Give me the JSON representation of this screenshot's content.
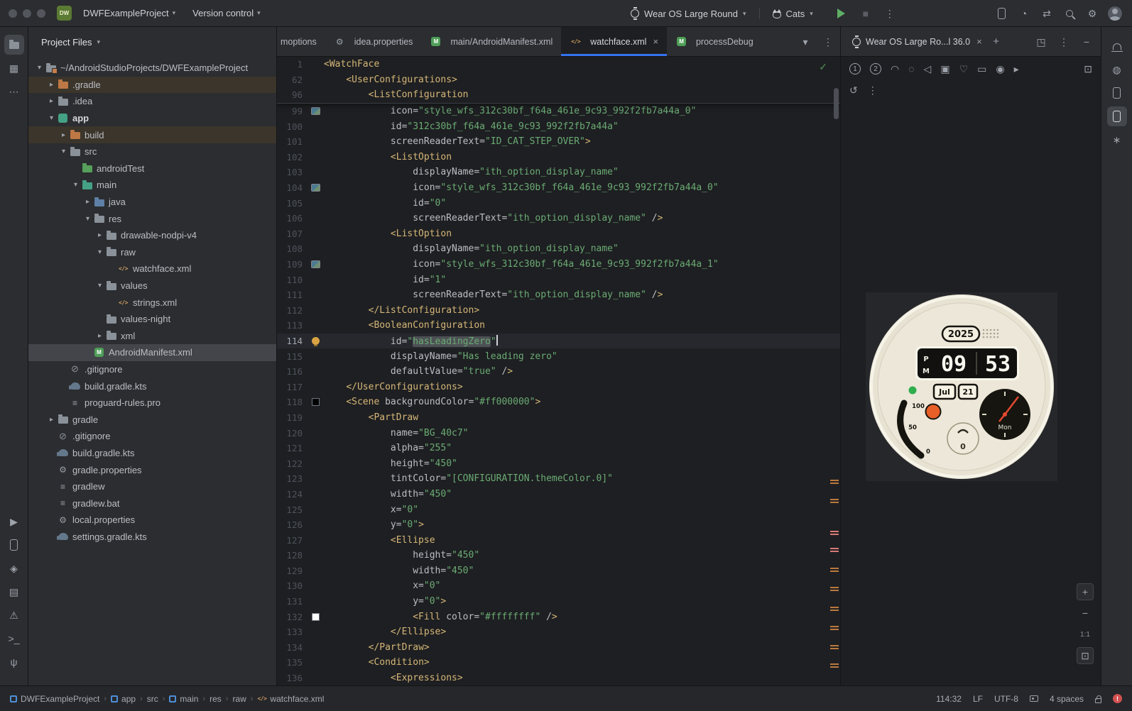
{
  "colors": {
    "chrome": "#2b2d30",
    "editor_bg": "#1e1f22",
    "accent_blue": "#3574f0",
    "tag_gold": "#d5b778",
    "string_green": "#6aab73",
    "run_green": "#5fad65",
    "error_red": "#d35050"
  },
  "titlebar": {
    "logo": "DW",
    "project_menu": "DWFExampleProject",
    "vcs_menu": "Version control",
    "device_selector": "Wear OS Large Round",
    "run_config": "Cats",
    "run_icons": [
      {
        "name": "run-button",
        "glyph": "run"
      },
      {
        "name": "stop-button",
        "glyph": "■"
      },
      {
        "name": "more-run-options-button",
        "glyph": "⋮"
      }
    ],
    "right_icons": [
      {
        "name": "device-mirror-button",
        "glyph": "phone"
      },
      {
        "name": "profiler-button",
        "glyph": "◔"
      },
      {
        "name": "sync-button",
        "glyph": "⇄"
      },
      {
        "name": "search-everywhere-button",
        "glyph": "mag"
      },
      {
        "name": "settings-button",
        "glyph": "⚙"
      },
      {
        "name": "account-button",
        "glyph": "avatar"
      }
    ]
  },
  "tool_strips": {
    "left_top": [
      {
        "name": "project-tool-button",
        "glyph": "folder",
        "active": true
      },
      {
        "name": "commit-tool-button",
        "glyph": "▦",
        "active": false
      },
      {
        "name": "more-tool-windows-button",
        "glyph": "⋯",
        "active": false
      }
    ],
    "left_bottom": [
      {
        "name": "run-tool-button",
        "glyph": "▶"
      },
      {
        "name": "device-manager-tool-button",
        "glyph": "phone"
      },
      {
        "name": "app-quality-insights-tool-button",
        "glyph": "◈"
      },
      {
        "name": "logcat-tool-button",
        "glyph": "▤"
      },
      {
        "name": "problems-tool-button",
        "glyph": "⚠"
      },
      {
        "name": "terminal-tool-button",
        "glyph": ">_"
      },
      {
        "name": "version-control-tool-button",
        "glyph": "ψ"
      }
    ],
    "right": [
      {
        "name": "notifications-button",
        "glyph": "bell",
        "active": false
      },
      {
        "name": "gradle-tool-button",
        "glyph": "◍",
        "active": false
      },
      {
        "name": "device-explorer-tool-button",
        "glyph": "phone",
        "active": false
      },
      {
        "name": "running-devices-tool-button",
        "glyph": "phone",
        "active": true
      },
      {
        "name": "gemini-tool-button",
        "glyph": "∗",
        "active": false
      }
    ]
  },
  "project": {
    "header": "Project Files",
    "tree": [
      {
        "d": 0,
        "label": "~/AndroidStudioProjects/DWFExampleProject",
        "icon": "project",
        "chev": "open"
      },
      {
        "d": 1,
        "label": ".gradle",
        "icon": "folder-ex",
        "chev": "closed",
        "row": "excluded"
      },
      {
        "d": 1,
        "label": ".idea",
        "icon": "folder",
        "chev": "closed"
      },
      {
        "d": 1,
        "label": "app",
        "icon": "module",
        "chev": "open",
        "bold": true
      },
      {
        "d": 2,
        "label": "build",
        "icon": "folder-ex",
        "chev": "closed",
        "row": "excluded"
      },
      {
        "d": 2,
        "label": "src",
        "icon": "folder",
        "chev": "open"
      },
      {
        "d": 3,
        "label": "androidTest",
        "icon": "folder-test",
        "chev": null
      },
      {
        "d": 3,
        "label": "main",
        "icon": "folder-main",
        "chev": "open"
      },
      {
        "d": 4,
        "label": "java",
        "icon": "folder-java",
        "chev": "closed"
      },
      {
        "d": 4,
        "label": "res",
        "icon": "folder",
        "chev": "open"
      },
      {
        "d": 5,
        "label": "drawable-nodpi-v4",
        "icon": "folder",
        "chev": "closed"
      },
      {
        "d": 5,
        "label": "raw",
        "icon": "folder",
        "chev": "open"
      },
      {
        "d": 6,
        "label": "watchface.xml",
        "icon": "xml",
        "chev": null
      },
      {
        "d": 5,
        "label": "values",
        "icon": "folder",
        "chev": "open"
      },
      {
        "d": 6,
        "label": "strings.xml",
        "icon": "xml",
        "chev": null
      },
      {
        "d": 5,
        "label": "values-night",
        "icon": "folder",
        "chev": null
      },
      {
        "d": 5,
        "label": "xml",
        "icon": "folder",
        "chev": "closed"
      },
      {
        "d": 4,
        "label": "AndroidManifest.xml",
        "icon": "manifest",
        "chev": null,
        "row": "selected"
      },
      {
        "d": 2,
        "label": ".gitignore",
        "icon": "git",
        "chev": null
      },
      {
        "d": 2,
        "label": "build.gradle.kts",
        "icon": "gradle",
        "chev": null
      },
      {
        "d": 2,
        "label": "proguard-rules.pro",
        "icon": "textfile",
        "chev": null
      },
      {
        "d": 1,
        "label": "gradle",
        "icon": "folder",
        "chev": "closed"
      },
      {
        "d": 1,
        "label": ".gitignore",
        "icon": "git",
        "chev": null
      },
      {
        "d": 1,
        "label": "build.gradle.kts",
        "icon": "gradle",
        "chev": null
      },
      {
        "d": 1,
        "label": "gradle.properties",
        "icon": "props",
        "chev": null
      },
      {
        "d": 1,
        "label": "gradlew",
        "icon": "textfile",
        "chev": null
      },
      {
        "d": 1,
        "label": "gradlew.bat",
        "icon": "textfile",
        "chev": null
      },
      {
        "d": 1,
        "label": "local.properties",
        "icon": "props",
        "chev": null
      },
      {
        "d": 1,
        "label": "settings.gradle.kts",
        "icon": "gradle",
        "chev": null
      }
    ]
  },
  "tabs": {
    "items": [
      {
        "label": "moptions",
        "icon": null,
        "cut": true
      },
      {
        "label": "idea.properties",
        "icon": "props"
      },
      {
        "label": "main/AndroidManifest.xml",
        "icon": "manifest"
      },
      {
        "label": "watchface.xml",
        "icon": "xml",
        "active": true,
        "close": true
      },
      {
        "label": "processDebug",
        "icon": "manifest",
        "truncate": true
      }
    ],
    "controls": [
      {
        "name": "hidden-tabs-button",
        "glyph": "▾"
      },
      {
        "name": "editor-options-button",
        "glyph": "⋮"
      }
    ]
  },
  "editor": {
    "sticky": [
      {
        "n": 1,
        "t": "<WatchFace"
      },
      {
        "n": 62,
        "t": "    <UserConfigurations>"
      },
      {
        "n": 96,
        "t": "        <ListConfiguration"
      }
    ],
    "lines": [
      {
        "n": 99,
        "t": "            icon=\"style_wfs_312c30bf_f64a_461e_9c93_992f2fb7a44a_0\"",
        "g": "img"
      },
      {
        "n": 100,
        "t": "            id=\"312c30bf_f64a_461e_9c93_992f2fb7a44a\""
      },
      {
        "n": 101,
        "t": "            screenReaderText=\"ID_CAT_STEP_OVER\">"
      },
      {
        "n": 102,
        "t": "            <ListOption"
      },
      {
        "n": 103,
        "t": "                displayName=\"ith_option_display_name\""
      },
      {
        "n": 104,
        "t": "                icon=\"style_wfs_312c30bf_f64a_461e_9c93_992f2fb7a44a_0\"",
        "g": "img"
      },
      {
        "n": 105,
        "t": "                id=\"0\""
      },
      {
        "n": 106,
        "t": "                screenReaderText=\"ith_option_display_name\" />"
      },
      {
        "n": 107,
        "t": "            <ListOption"
      },
      {
        "n": 108,
        "t": "                displayName=\"ith_option_display_name\""
      },
      {
        "n": 109,
        "t": "                icon=\"style_wfs_312c30bf_f64a_461e_9c93_992f2fb7a44a_1\"",
        "g": "img"
      },
      {
        "n": 110,
        "t": "                id=\"1\""
      },
      {
        "n": 111,
        "t": "                screenReaderText=\"ith_option_display_name\" />"
      },
      {
        "n": 112,
        "t": "        </ListConfiguration>"
      },
      {
        "n": 113,
        "t": "        <BooleanConfiguration"
      },
      {
        "n": 114,
        "t": "            id=\"hasLeadingZero\"",
        "g": "bulb",
        "caret": true,
        "sel": "hasLeadingZero"
      },
      {
        "n": 115,
        "t": "            displayName=\"Has leading zero\""
      },
      {
        "n": 116,
        "t": "            defaultValue=\"true\" />"
      },
      {
        "n": 117,
        "t": "    </UserConfigurations>"
      },
      {
        "n": 118,
        "t": "    <Scene backgroundColor=\"#ff000000\">",
        "g": "swatch:#000000"
      },
      {
        "n": 119,
        "t": "        <PartDraw"
      },
      {
        "n": 120,
        "t": "            name=\"BG_40c7\""
      },
      {
        "n": 121,
        "t": "            alpha=\"255\""
      },
      {
        "n": 122,
        "t": "            height=\"450\""
      },
      {
        "n": 123,
        "t": "            tintColor=\"[CONFIGURATION.themeColor.0]\""
      },
      {
        "n": 124,
        "t": "            width=\"450\""
      },
      {
        "n": 125,
        "t": "            x=\"0\""
      },
      {
        "n": 126,
        "t": "            y=\"0\">"
      },
      {
        "n": 127,
        "t": "            <Ellipse"
      },
      {
        "n": 128,
        "t": "                height=\"450\""
      },
      {
        "n": 129,
        "t": "                width=\"450\""
      },
      {
        "n": 130,
        "t": "                x=\"0\""
      },
      {
        "n": 131,
        "t": "                y=\"0\">"
      },
      {
        "n": 132,
        "t": "                <Fill color=\"#ffffffff\" />",
        "g": "swatch:#ffffff"
      },
      {
        "n": 133,
        "t": "            </Ellipse>"
      },
      {
        "n": 134,
        "t": "        </PartDraw>"
      },
      {
        "n": 135,
        "t": "        <Condition>"
      },
      {
        "n": 136,
        "t": "            <Expressions>"
      }
    ],
    "stripe": [
      {
        "t": 596,
        "c": "#b9793e"
      },
      {
        "t": 623,
        "c": "#b9793e"
      },
      {
        "t": 668,
        "c": "#d57b74"
      },
      {
        "t": 692,
        "c": "#d57b74"
      },
      {
        "t": 720,
        "c": "#b9793e"
      },
      {
        "t": 747,
        "c": "#b9793e"
      },
      {
        "t": 775,
        "c": "#b9793e"
      },
      {
        "t": 802,
        "c": "#b9793e"
      },
      {
        "t": 829,
        "c": "#b9793e"
      },
      {
        "t": 855,
        "c": "#b9793e"
      }
    ]
  },
  "device_panel": {
    "tab_label": "Wear OS Large Ro...l 36.0",
    "header_icons": [
      {
        "name": "open-in-window-button",
        "glyph": "◳"
      },
      {
        "name": "panel-options-button",
        "glyph": "⋮"
      },
      {
        "name": "hide-panel-button",
        "glyph": "−"
      }
    ],
    "toolbar": [
      {
        "name": "wear-button-1",
        "glyph": "1",
        "circle": true
      },
      {
        "name": "wear-button-2",
        "glyph": "2",
        "circle": true
      },
      {
        "name": "palm-gesture-button",
        "glyph": "◠"
      },
      {
        "name": "power-button",
        "glyph": "◌"
      },
      {
        "name": "back-button",
        "glyph": "◁"
      },
      {
        "name": "screenshot-button",
        "glyph": "▣"
      },
      {
        "name": "heart-rate-button",
        "glyph": "♡"
      },
      {
        "name": "pair-button",
        "glyph": "▭"
      },
      {
        "name": "camera-button",
        "glyph": "◉"
      },
      {
        "name": "record-button",
        "glyph": "▸"
      }
    ],
    "fullscreen_glyph": "⊡",
    "toolbar2": [
      {
        "name": "reset-view-button",
        "glyph": "↺"
      },
      {
        "name": "toolbar-more-button",
        "glyph": "⋮"
      }
    ],
    "zoom": [
      {
        "name": "zoom-in-button",
        "glyph": "+",
        "boxed": true
      },
      {
        "name": "zoom-out-button",
        "glyph": "−",
        "boxed": false
      },
      {
        "name": "zoom-level-label",
        "glyph": "1:1",
        "boxed": false,
        "label": true
      },
      {
        "name": "zoom-to-fit-button",
        "glyph": "⊡",
        "boxed": true
      }
    ],
    "watch": {
      "year": "2025",
      "ampm_p": "P",
      "ampm_m": "M",
      "hour": "09",
      "minute": "53",
      "month": "Jul",
      "day": "21",
      "weekday": "Mon",
      "gauge_labels": [
        "100",
        "50",
        "0"
      ],
      "counter": "0"
    }
  },
  "statusbar": {
    "breadcrumbs": [
      {
        "label": "DWFExampleProject",
        "icon": "module"
      },
      {
        "label": "app",
        "icon": "module"
      },
      {
        "label": "src",
        "icon": null
      },
      {
        "label": "main",
        "icon": "module"
      },
      {
        "label": "res",
        "icon": null
      },
      {
        "label": "raw",
        "icon": null
      },
      {
        "label": "watchface.xml",
        "icon": "xml"
      }
    ],
    "caret": "114:32",
    "line_sep": "LF",
    "encoding": "UTF-8",
    "indent": "4 spaces"
  }
}
